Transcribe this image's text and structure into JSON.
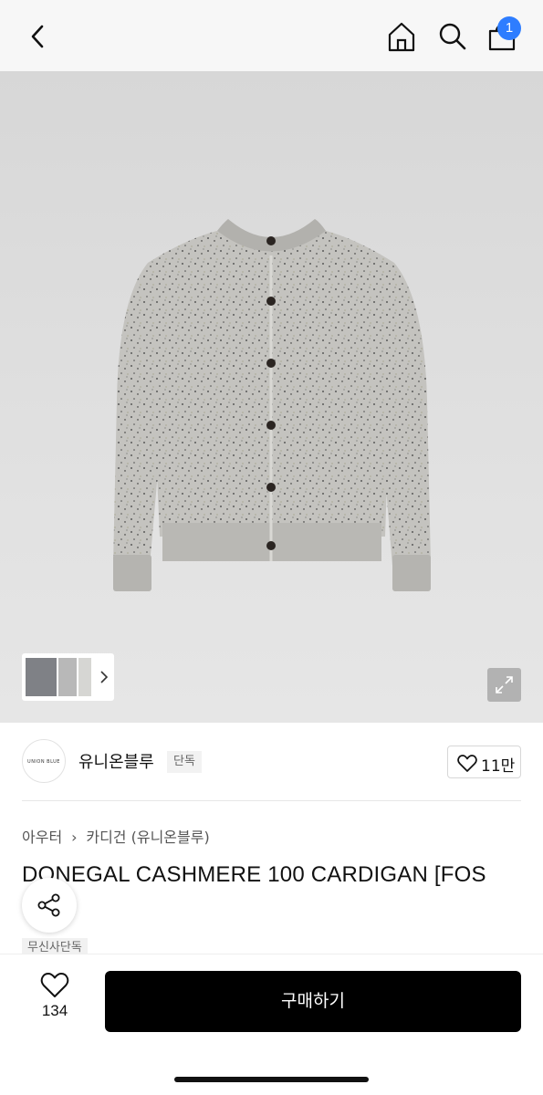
{
  "header": {
    "back_icon": "chevron-left-icon",
    "home_icon": "home-icon",
    "search_icon": "search-icon",
    "cart_icon": "shopping-bag-icon",
    "cart_count": "1",
    "badge_color": "#2e7dff"
  },
  "gallery": {
    "thumbnail_more_icon": "chevron-right-icon",
    "zoom_icon": "expand-icon"
  },
  "brand": {
    "logo_text": "UNION BLUE",
    "name": "유니온블루",
    "exclusive_label": "단독",
    "like_count": "11만"
  },
  "product": {
    "breadcrumb": [
      "아우터",
      "카디건 (유니온블루)"
    ],
    "title": "DONEGAL CASHMERE 100 CARDIGAN [FOS",
    "musinsa_tag": "무신사단독"
  },
  "actions": {
    "share_icon": "share-icon",
    "wish_icon": "heart-icon",
    "wish_count": "134",
    "buy_label": "구매하기"
  }
}
